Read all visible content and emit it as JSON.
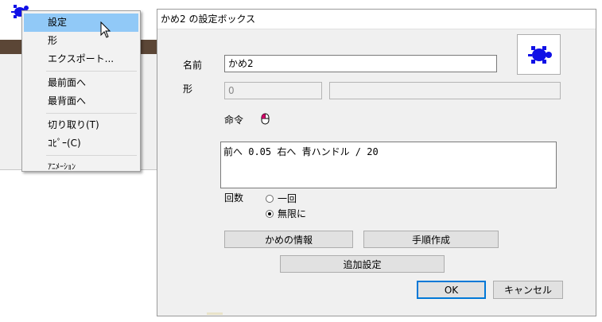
{
  "context_menu": {
    "items": [
      {
        "label": "設定"
      },
      {
        "label": "形"
      },
      {
        "label": "エクスポート..."
      },
      {
        "label": "最前面へ"
      },
      {
        "label": "最背面へ"
      },
      {
        "label": "切り取り(T)"
      },
      {
        "label": "ｺﾋﾟｰ(C)"
      },
      {
        "label": "ｱﾆﾒｰｼｮﾝ"
      }
    ],
    "highlighted": "設定"
  },
  "dialog": {
    "title": "かめ2 の設定ボックス",
    "name_label": "名前",
    "name_value": "かめ2",
    "shape_label": "形",
    "shape_value": "0",
    "shape_value2": "",
    "command_label": "命令",
    "command_text": "前へ 0.05 右へ 青ハンドル / 20",
    "count_label": "回数",
    "count_options": [
      {
        "label": "一回",
        "checked": false
      },
      {
        "label": "無限に",
        "checked": true
      }
    ],
    "buttons": {
      "info": "かめの情報",
      "procedure": "手順作成",
      "additional": "追加設定",
      "ok": "OK",
      "cancel": "キャンセル"
    }
  },
  "colors": {
    "turtle": "#1010e6",
    "menu_highlight": "#91c9f7",
    "band": "#5b4636"
  },
  "icons": [
    "turtle-icon",
    "mouse-icon",
    "pointer-cursor-icon"
  ]
}
